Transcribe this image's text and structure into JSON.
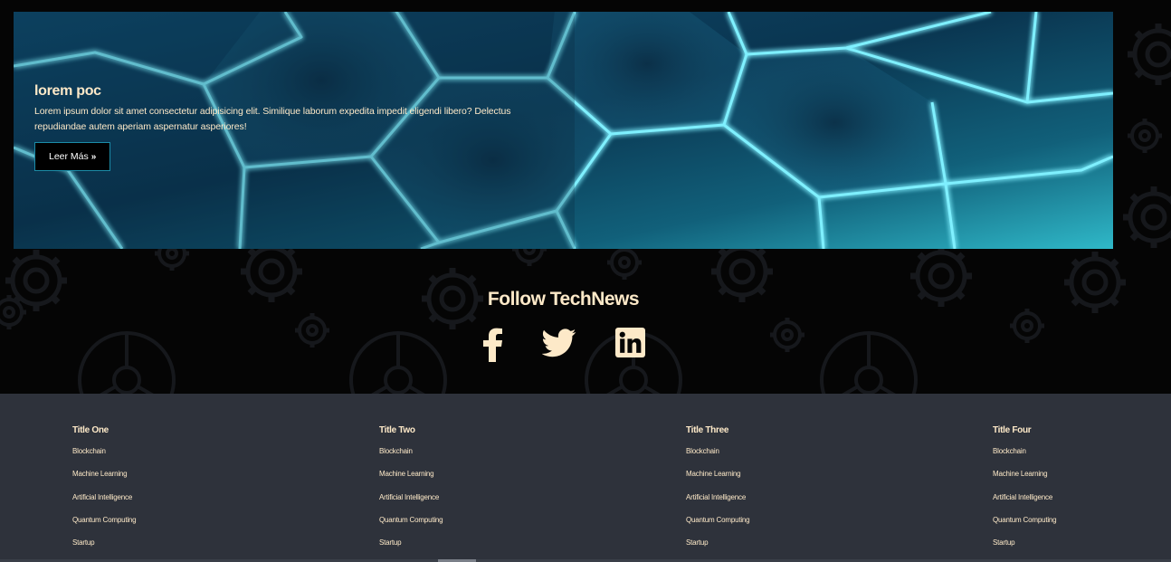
{
  "hero": {
    "title": "lorem poc",
    "text": "Lorem ipsum dolor sit amet consectetur adipisicing elit. Similique laborum expedita impedit eligendi libero? Delectus repudiandae autem aperiam aspernatur asperiores!",
    "button_label": "Leer Más",
    "button_icon": "double-chevron-right-icon"
  },
  "follow": {
    "title": "Follow TechNews",
    "socials": [
      {
        "name": "facebook-icon"
      },
      {
        "name": "twitter-icon"
      },
      {
        "name": "linkedin-icon"
      }
    ]
  },
  "footer": {
    "columns": [
      {
        "title": "Title One",
        "items": [
          "Blockchain",
          "Machine Learning",
          "Artificial Intelligence",
          "Quantum Computing",
          "Startup"
        ]
      },
      {
        "title": "Title Two",
        "items": [
          "Blockchain",
          "Machine Learning",
          "Artificial Intelligence",
          "Quantum Computing",
          "Startup"
        ]
      },
      {
        "title": "Title Three",
        "items": [
          "Blockchain",
          "Machine Learning",
          "Artificial Intelligence",
          "Quantum Computing",
          "Startup"
        ]
      },
      {
        "title": "Title Four",
        "items": [
          "Blockchain",
          "Machine Learning",
          "Artificial Intelligence",
          "Quantum Computing",
          "Startup"
        ]
      }
    ]
  },
  "colors": {
    "accent_text": "#fde9c8",
    "footer_bg": "#2e323b",
    "page_bg": "#050505",
    "hex_glow": "#5fe3ff"
  }
}
